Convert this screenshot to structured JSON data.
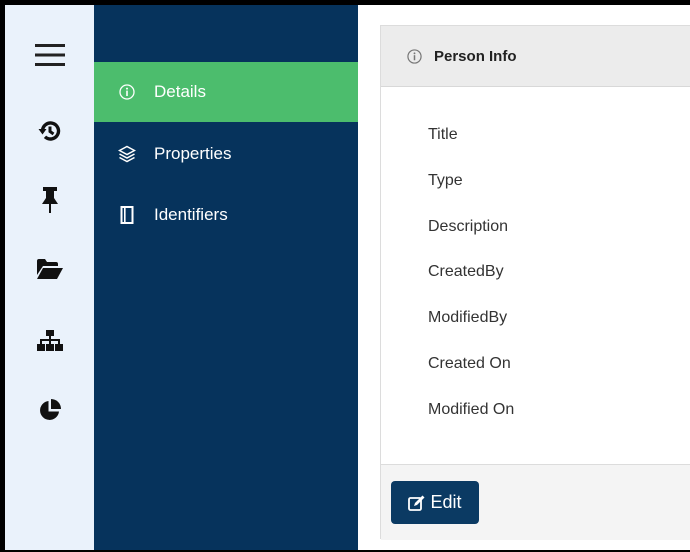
{
  "rail": {
    "items": [
      {
        "icon": "hamburger-menu-icon"
      },
      {
        "icon": "history-icon"
      },
      {
        "icon": "pin-icon"
      },
      {
        "icon": "folder-open-icon"
      },
      {
        "icon": "sitemap-icon"
      },
      {
        "icon": "pie-chart-icon"
      }
    ]
  },
  "nav": {
    "items": [
      {
        "label": "Details",
        "icon": "info-circle-icon",
        "active": true
      },
      {
        "label": "Properties",
        "icon": "layers-icon",
        "active": false
      },
      {
        "label": "Identifiers",
        "icon": "id-book-icon",
        "active": false
      }
    ]
  },
  "card": {
    "title": "Person Info",
    "title_icon": "info-circle-icon",
    "fields": [
      "Title",
      "Type",
      "Description",
      "CreatedBy",
      "ModifiedBy",
      "Created On",
      "Modified On"
    ],
    "edit_label": "Edit"
  },
  "colors": {
    "rail_bg": "#eaf2fb",
    "nav_bg": "#06335c",
    "nav_active": "#4cbd6d",
    "button_bg": "#0b3a63"
  }
}
